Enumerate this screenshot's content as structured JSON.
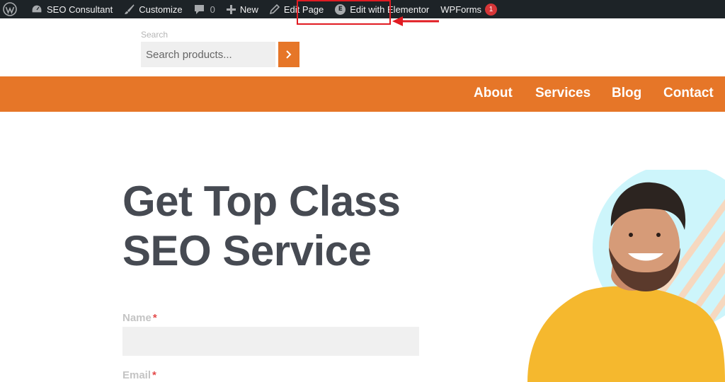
{
  "admin_bar": {
    "site_name": "SEO Consultant",
    "customize": "Customize",
    "comments_count": "0",
    "new": "New",
    "edit_page": "Edit Page",
    "edit_with_elementor": "Edit with Elementor",
    "elementor_badge": "E",
    "wpforms": "WPForms",
    "wpforms_badge": "1"
  },
  "search": {
    "label": "Search",
    "placeholder": "Search products..."
  },
  "nav": {
    "items": [
      "About",
      "Services",
      "Blog",
      "Contact"
    ]
  },
  "hero": {
    "title_line1": "Get Top Class",
    "title_line2": "SEO Service"
  },
  "form": {
    "name_label": "Name",
    "email_label": "Email",
    "required_marker": "*"
  },
  "colors": {
    "accent": "#e67628",
    "admin_bar_bg": "#1d2327",
    "highlight": "#e11b22",
    "title": "#464a52"
  }
}
